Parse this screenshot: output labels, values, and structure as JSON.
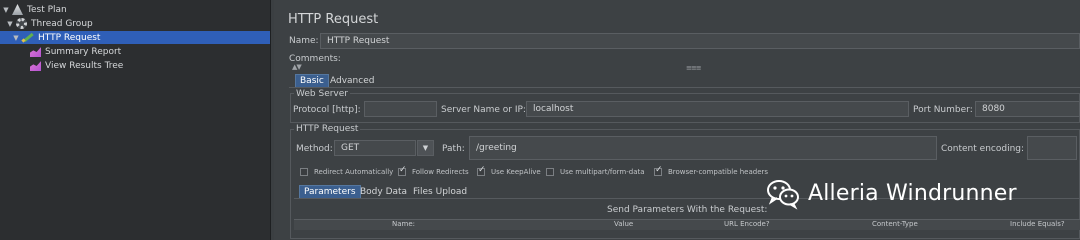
{
  "tree": {
    "items": [
      {
        "label": "Test Plan",
        "icon": "test-plan-icon"
      },
      {
        "label": "Thread Group",
        "icon": "gear-icon"
      },
      {
        "label": "HTTP Request",
        "icon": "sampler-pen-icon",
        "selected": true
      },
      {
        "label": "Summary Report",
        "icon": "chart-icon"
      },
      {
        "label": "View Results Tree",
        "icon": "chart-icon"
      }
    ]
  },
  "panel": {
    "title": "HTTP Request",
    "name_label": "Name:",
    "name_value": "HTTP Request",
    "comments_label": "Comments:",
    "tabs": [
      {
        "label": "Basic",
        "active": true
      },
      {
        "label": "Advanced"
      }
    ],
    "web_server": {
      "group_label": "Web Server",
      "protocol_label": "Protocol [http]:",
      "protocol_value": "",
      "server_label": "Server Name or IP:",
      "server_value": "localhost",
      "port_label": "Port Number:",
      "port_value": "8080"
    },
    "http_request": {
      "group_label": "HTTP Request",
      "method_label": "Method:",
      "method_value": "GET",
      "path_label": "Path:",
      "path_value": "/greeting",
      "encoding_label": "Content encoding:",
      "encoding_value": ""
    },
    "options": [
      {
        "label": "Redirect Automatically",
        "checked": false
      },
      {
        "label": "Follow Redirects",
        "checked": true
      },
      {
        "label": "Use KeepAlive",
        "checked": true
      },
      {
        "label": "Use multipart/form-data",
        "checked": false
      },
      {
        "label": "Browser-compatible headers",
        "checked": true
      }
    ],
    "param_tabs": [
      {
        "label": "Parameters",
        "active": true
      },
      {
        "label": "Body Data"
      },
      {
        "label": "Files Upload"
      }
    ],
    "params_caption": "Send Parameters With the Request:",
    "columns": [
      "Name:",
      "Value",
      "URL Encode?",
      "Content-Type",
      "Include Equals?"
    ]
  },
  "watermark": {
    "text": "Alleria Windrunner",
    "icon": "wechat-icon"
  },
  "colors": {
    "selection": "#2f5fb8",
    "tab_active": "#3b5f8f",
    "background": "#3d4144"
  }
}
